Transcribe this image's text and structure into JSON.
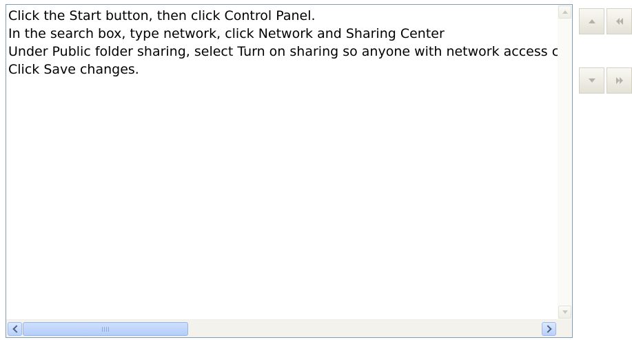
{
  "listbox": {
    "lines": [
      "Click the Start button, then click Control Panel.",
      "In the search box, type network, click Network and Sharing Center",
      "Under Public folder sharing, select Turn on sharing so anyone with network access can open files",
      "Click Save changes."
    ]
  },
  "icons": {
    "scroll_up": "triangle-up-icon",
    "scroll_down": "triangle-down-icon",
    "scroll_left": "chevron-left-icon",
    "scroll_right": "chevron-right-icon",
    "move_up": "triangle-up-icon",
    "move_down": "triangle-down-icon",
    "move_first": "double-left-arrow-icon",
    "move_last": "double-right-arrow-icon"
  },
  "colors": {
    "border": "#7f9db9",
    "scroll_thumb": "#b4cdfa",
    "disabled_glyph": "#b4b2a6"
  }
}
